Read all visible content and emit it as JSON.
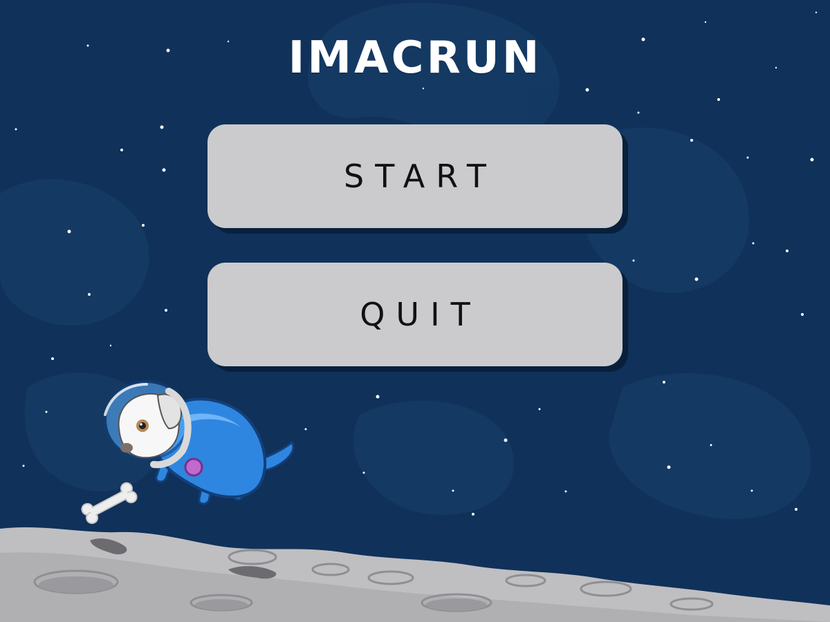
{
  "title": "IMACRUN",
  "menu": {
    "start_label": "START",
    "quit_label": "QUIT"
  },
  "colors": {
    "sky": "#10315a",
    "button": "#cbcbcd",
    "button_shadow": "#08203b",
    "moon": "#bfbfc2",
    "dog_suit": "#2f86e0"
  },
  "sprites": {
    "player": "astronaut-dog",
    "pickup": "bone-icon",
    "ground": "moon-surface"
  }
}
